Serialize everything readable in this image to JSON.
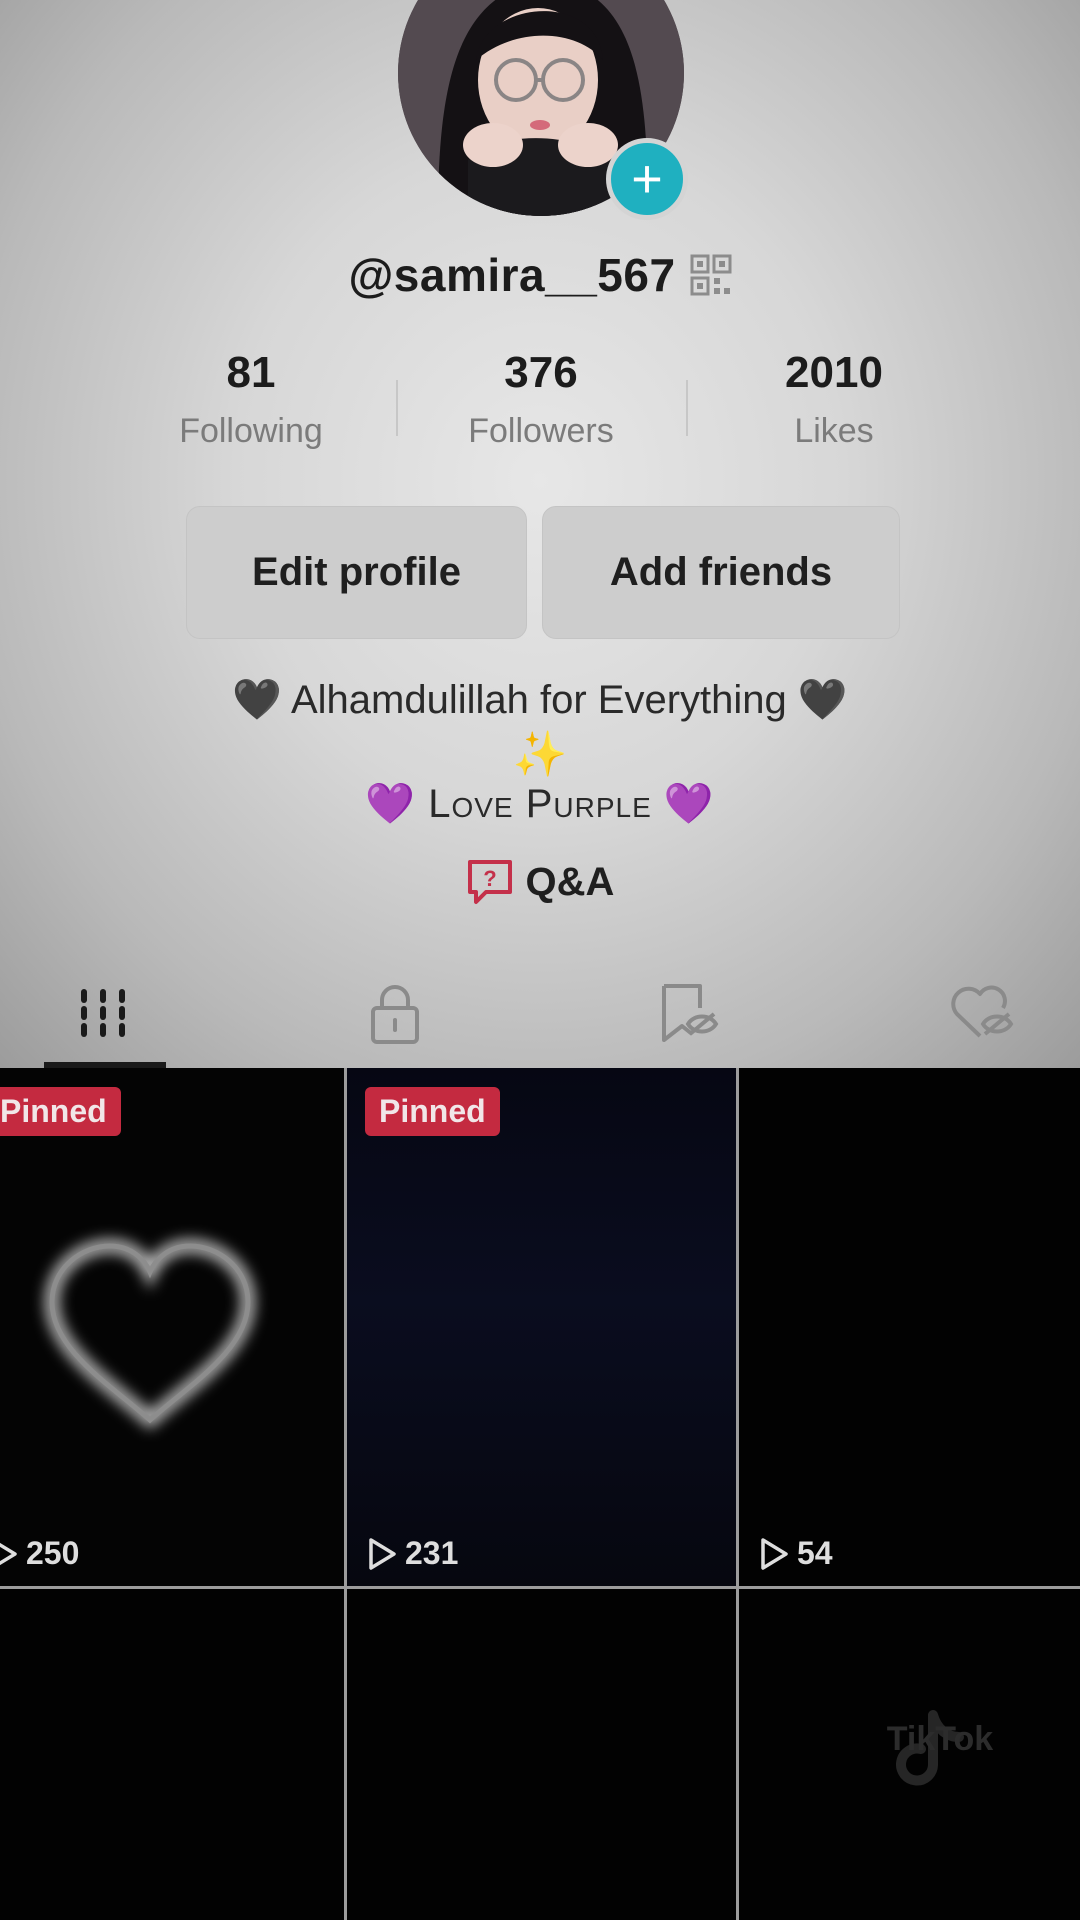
{
  "profile": {
    "username": "@samira__567",
    "stats": [
      {
        "value": "81",
        "label": "Following"
      },
      {
        "value": "376",
        "label": "Followers"
      },
      {
        "value": "2010",
        "label": "Likes"
      }
    ],
    "buttons": {
      "edit": "Edit profile",
      "add": "Add friends"
    },
    "bio": {
      "line1": "🖤 Alhamdulillah  for  Everything 🖤",
      "line2": "✨",
      "line3": "💜 Love Purple 💜"
    },
    "qa_label": "Q&A"
  },
  "tabs": [
    {
      "icon": "grid-icon",
      "active": true
    },
    {
      "icon": "lock-icon",
      "active": false
    },
    {
      "icon": "bookmark-hidden-icon",
      "active": false
    },
    {
      "icon": "heart-hidden-icon",
      "active": false
    }
  ],
  "videos": [
    {
      "pinned_label": "Pinned",
      "views": "250"
    },
    {
      "pinned_label": "Pinned",
      "views": "231"
    },
    {
      "pinned_label": "",
      "views": "54"
    },
    {
      "pinned_label": "",
      "views": ""
    },
    {
      "pinned_label": "",
      "views": ""
    },
    {
      "pinned_label": "",
      "views": ""
    }
  ],
  "watermark": "TikTok",
  "colors": {
    "accent": "#1fb0c0",
    "pinned_badge": "#c42a40",
    "qa_icon": "#c4304a"
  }
}
